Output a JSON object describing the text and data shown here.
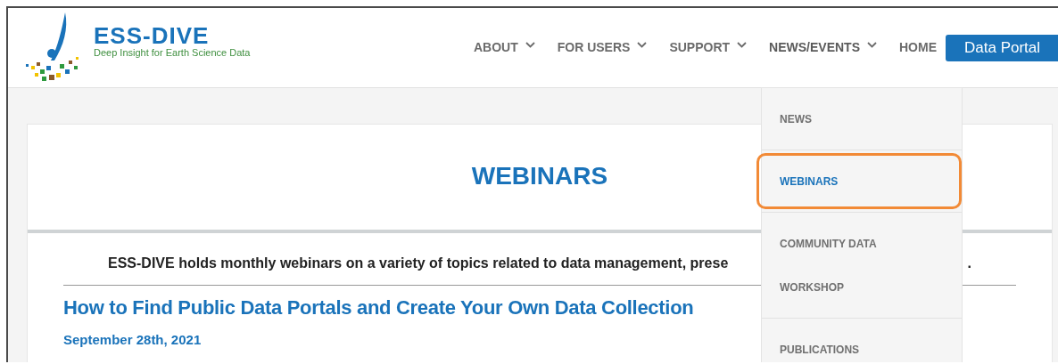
{
  "logo": {
    "name": "ESS-DIVE",
    "tagline": "Deep Insight for Earth Science Data"
  },
  "nav": [
    {
      "label": "ABOUT",
      "has_dropdown": true,
      "expanded": false
    },
    {
      "label": "FOR USERS",
      "has_dropdown": true,
      "expanded": false
    },
    {
      "label": "SUPPORT",
      "has_dropdown": true,
      "expanded": false
    },
    {
      "label": "NEWS/EVENTS",
      "has_dropdown": true,
      "expanded": true
    },
    {
      "label": "HOME",
      "has_dropdown": false,
      "expanded": false
    }
  ],
  "portal_button": "Data Portal",
  "dropdown": [
    {
      "label": "NEWS",
      "selected": false,
      "highlighted": false,
      "divider_after": true
    },
    {
      "label": "WEBINARS",
      "selected": true,
      "highlighted": true,
      "divider_after": true
    },
    {
      "label": "COMMUNITY DATA",
      "selected": false,
      "highlighted": false,
      "divider_after": false
    },
    {
      "label": "WORKSHOP",
      "selected": false,
      "highlighted": false,
      "divider_after": true
    },
    {
      "label": "PUBLICATIONS",
      "selected": false,
      "highlighted": false,
      "divider_after": false
    }
  ],
  "page_title": "WEBINARS",
  "intro": "ESS-DIVE holds monthly webinars on a variety of topics related to data management, prese",
  "intro_end": ".",
  "webinar": {
    "title": "How to Find Public Data Portals and Create Your Own Data Collection",
    "date": "September 28th, 2021"
  }
}
